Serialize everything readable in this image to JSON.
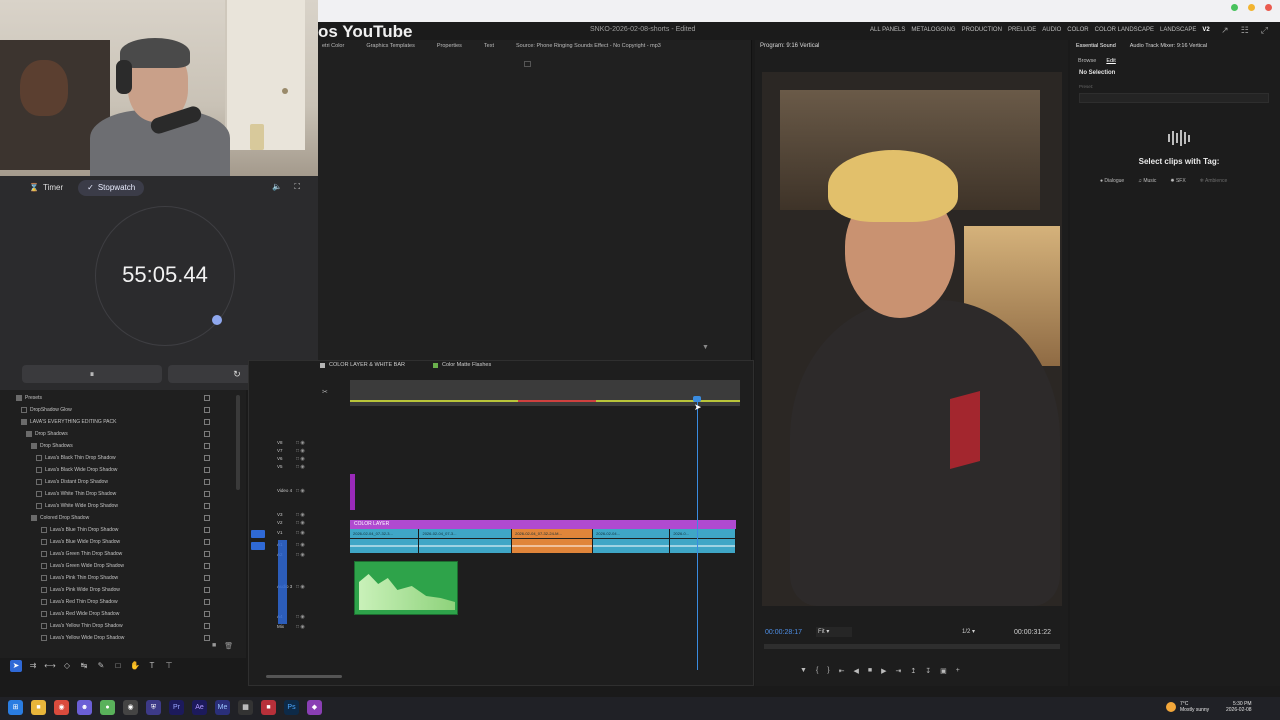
{
  "window": {
    "partial_title": "os YouTube",
    "document_title": "SNKO-2026-02-08-shorts - Edited",
    "workspaces": [
      "ALL PANELS",
      "METALOGGING",
      "PRODUCTION",
      "PRELUDE",
      "AUDIO",
      "COLOR",
      "COLOR LANDSCAPE",
      "LANDSCAPE",
      "V2"
    ]
  },
  "source_panel": {
    "tabs": [
      "etri Color",
      "Graphics Templates",
      "Properties",
      "Text",
      "Source: Phone Ringing Sounds Effect - No Copyright - mp3"
    ]
  },
  "timer_widget": {
    "tab_timer": "Timer",
    "tab_stopwatch": "Stopwatch",
    "time": "55:05.44",
    "pause_icon": "⏸",
    "reset_icon": "↻",
    "progress": 0.85
  },
  "effects": {
    "items": [
      {
        "label": "Presets",
        "indent": 0,
        "folder": true
      },
      {
        "label": "DropShadow Glow",
        "indent": 1,
        "folder": false
      },
      {
        "label": "LAVA'S EVERYTHING EDITING PACK",
        "indent": 1,
        "folder": true
      },
      {
        "label": "Drop Shadows",
        "indent": 2,
        "folder": true
      },
      {
        "label": "Drop Shadows",
        "indent": 3,
        "folder": true
      },
      {
        "label": "Lava's Black Thin Drop Shadow",
        "indent": 4,
        "folder": false
      },
      {
        "label": "Lava's Black Wide Drop Shadow",
        "indent": 4,
        "folder": false
      },
      {
        "label": "Lava's Distant Drop Shadow",
        "indent": 4,
        "folder": false
      },
      {
        "label": "Lava's White Thin Drop Shadow",
        "indent": 4,
        "folder": false
      },
      {
        "label": "Lava's White Wide Drop Shadow",
        "indent": 4,
        "folder": false
      },
      {
        "label": "Colored Drop Shadow",
        "indent": 3,
        "folder": true
      },
      {
        "label": "Lava's Blue Thin Drop Shadow",
        "indent": 5,
        "folder": false
      },
      {
        "label": "Lava's Blue Wide Drop Shadow",
        "indent": 5,
        "folder": false
      },
      {
        "label": "Lava's Green Thin Drop Shadow",
        "indent": 5,
        "folder": false
      },
      {
        "label": "Lava's Green Wide Drop Shadow",
        "indent": 5,
        "folder": false
      },
      {
        "label": "Lava's Pink Thin Drop Shadow",
        "indent": 5,
        "folder": false
      },
      {
        "label": "Lava's Pink Wide Drop Shadow",
        "indent": 5,
        "folder": false
      },
      {
        "label": "Lava's Red Thin Drop Shadow",
        "indent": 5,
        "folder": false
      },
      {
        "label": "Lava's Red Wide Drop Shadow",
        "indent": 5,
        "folder": false
      },
      {
        "label": "Lava's Yellow Thin Drop Shadow",
        "indent": 5,
        "folder": false
      },
      {
        "label": "Lava's Yellow Wide Drop Shadow",
        "indent": 5,
        "folder": false
      }
    ]
  },
  "timeline": {
    "tabs": [
      "COLOR LAYER & WHITE BAR",
      "Color Matte Flashes"
    ],
    "tracks": [
      "V8",
      "V7",
      "V6",
      "V5",
      "Video 4",
      "V3",
      "V2",
      "V1",
      "A1",
      "A2",
      "Audio 3",
      "A4",
      "Mix"
    ],
    "color_layer_label": "COLOR LAYER",
    "clips": [
      {
        "label": "2026-02-04_07-32-3...",
        "color": "#3fa6c6"
      },
      {
        "label": "2026-02-04_07-3...",
        "color": "#3fa6c6"
      },
      {
        "label": "2026-02-04_07-32-24-M...",
        "color": "#e0853a"
      },
      {
        "label": "2026-02-04...",
        "color": "#3fa6c6"
      },
      {
        "label": "2026-0...",
        "color": "#3fa6c6"
      }
    ]
  },
  "program_monitor": {
    "title": "Program: 9:16 Vertical",
    "timecode": "00:00:28:17",
    "fit": "Fit",
    "resolution": "1/2",
    "duration": "00:00:31:22"
  },
  "essential_sound": {
    "tabs": [
      "Essential Sound",
      "Audio Track Mixer: 9:16 Vertical"
    ],
    "subtabs": [
      "Browse",
      "Edit"
    ],
    "no_selection": "No Selection",
    "preset": "Preset:",
    "heading": "Select clips with Tag:",
    "tags": [
      "Dialogue",
      "Music",
      "SFX",
      "Ambience"
    ]
  },
  "taskbar": {
    "weather_temp": "7°C",
    "weather_desc": "Mostly sunny",
    "time": "5:30 PM",
    "date": "2026-02-08"
  },
  "colors": {
    "accent": "#2f69d6",
    "playhead": "#3a8ce0",
    "clip_cyan": "#3fa6c6",
    "clip_orange": "#e0853a",
    "color_layer": "#b04ad0",
    "audio_green": "#2ea34a"
  }
}
